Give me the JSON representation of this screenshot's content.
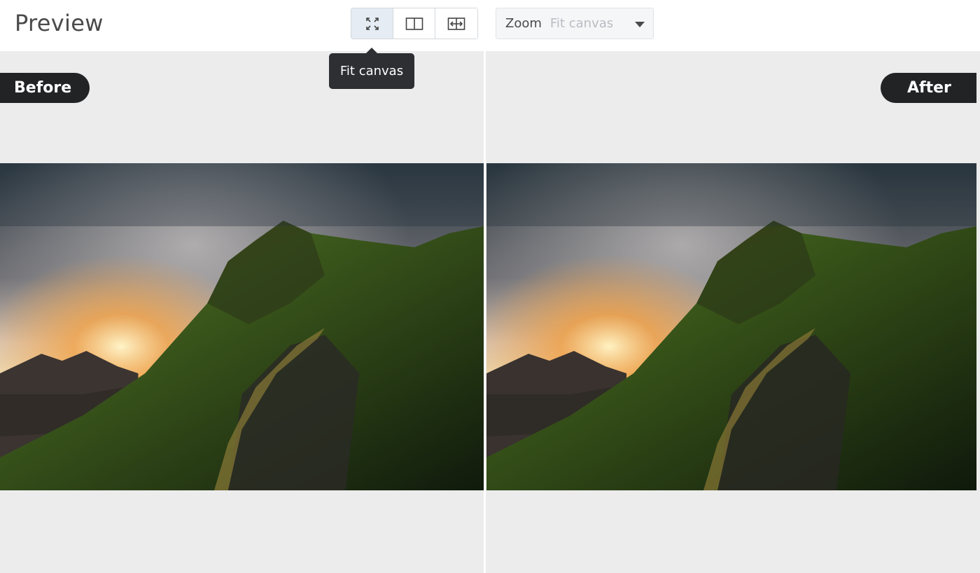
{
  "header": {
    "title": "Preview",
    "view_modes": [
      {
        "name": "fit-canvas",
        "icon": "fit-canvas-icon",
        "active": true
      },
      {
        "name": "split-view",
        "icon": "split-view-icon",
        "active": false
      },
      {
        "name": "slider-compare",
        "icon": "slider-compare-icon",
        "active": false
      }
    ],
    "zoom": {
      "label": "Zoom",
      "value": "Fit canvas"
    }
  },
  "tooltip": {
    "text": "Fit canvas"
  },
  "preview": {
    "before_label": "Before",
    "after_label": "After"
  },
  "colors": {
    "active_button": "#e5ecf4",
    "pill_background": "#222325",
    "canvas_background": "#ececec",
    "tooltip_background": "#2d2f33"
  }
}
